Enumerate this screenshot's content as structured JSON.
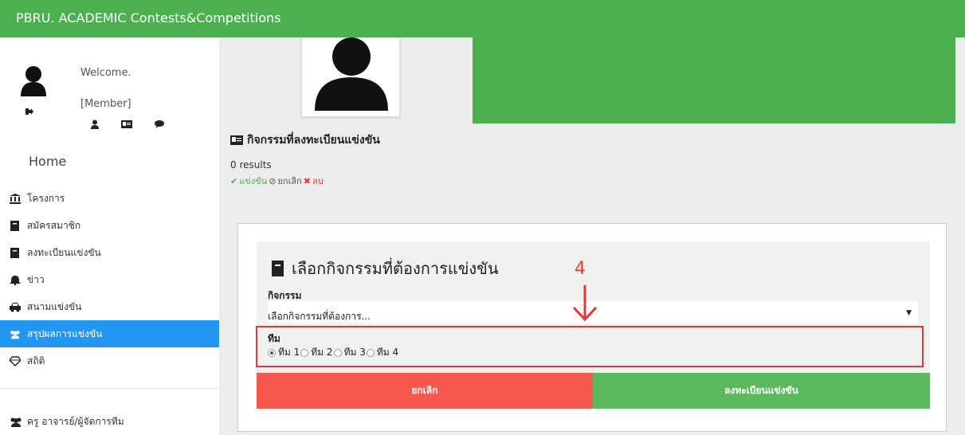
{
  "app": {
    "title": "PBRU. ACADEMIC Contests&Competitions",
    "accent": "#4caf50"
  },
  "user": {
    "welcome": "Welcome.",
    "role": "[Member]"
  },
  "sidebar": {
    "home": "Home",
    "items": [
      {
        "label": "โครงการ",
        "icon": "bank-icon"
      },
      {
        "label": "สมัครสมาชิก",
        "icon": "book-icon"
      },
      {
        "label": "ลงทะเบียนแข่งขัน",
        "icon": "book-icon"
      },
      {
        "label": "ข่าว",
        "icon": "bell-icon"
      },
      {
        "label": "สนามแข่งขัน",
        "icon": "car-icon"
      },
      {
        "label": "สรุปผลการแข่งขัน",
        "icon": "users-icon",
        "active": true
      },
      {
        "label": "สถิติ",
        "icon": "diamond-icon"
      }
    ],
    "teacher": "ครู อาจารย์/ผู้จัดการทีม"
  },
  "registered": {
    "title": "กิจกรรมที่ลงทะเบียนแข่งขัน",
    "results": "0 results",
    "legend": {
      "compete": "แข่งขัน",
      "cancel": "ยกเลิก",
      "delete": "ลบ"
    }
  },
  "form": {
    "title": "เลือกกิจกรรมที่ต้องการแข่งขัน",
    "activity_label": "กิจกรรม",
    "activity_selected": "เลือกกิจกรรมที่ต้องการ...",
    "team_label": "ทีม",
    "teams": [
      "ทีม 1",
      "ทีม 2",
      "ทีม 3",
      "ทีม 4"
    ],
    "selected_team": 0,
    "cancel_label": "ยกเลิก",
    "register_label": "ลงทะเบียนแข่งขัน"
  },
  "annotation": {
    "number": "4",
    "color": "#e53935"
  }
}
